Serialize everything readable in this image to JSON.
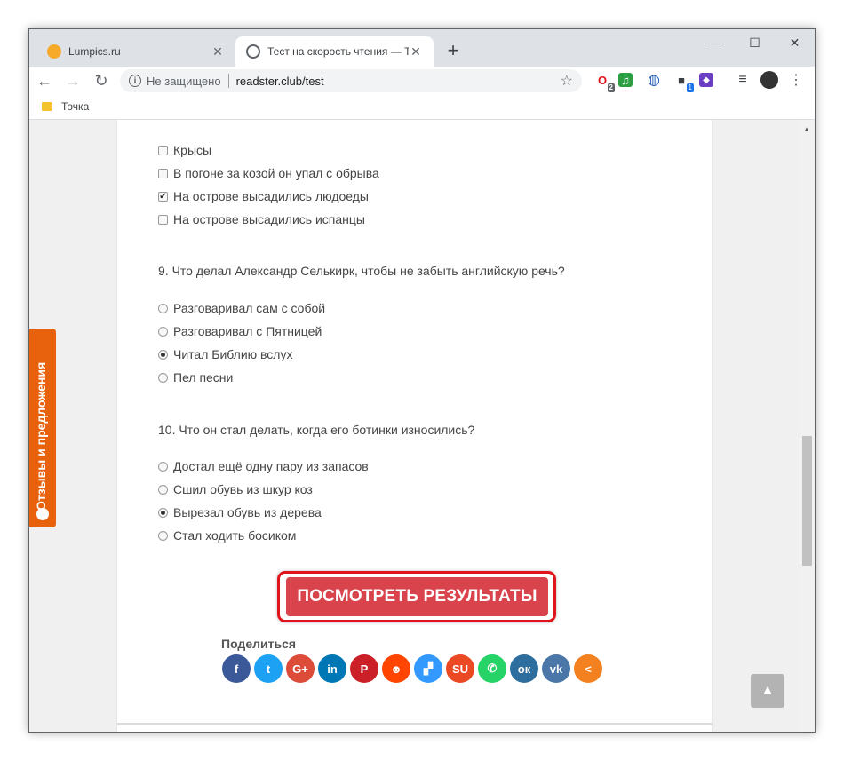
{
  "tabs": [
    {
      "title": "Lumpics.ru",
      "favicon_color": "#f7a92a",
      "active": false
    },
    {
      "title": "Тест на скорость чтения — Тре",
      "favicon_color": "#5f6368",
      "active": true
    }
  ],
  "new_tab_label": "+",
  "window_controls": {
    "minimize": "—",
    "maximize": "☐",
    "close": "✕"
  },
  "nav": {
    "back": "←",
    "forward": "→",
    "reload": "↻"
  },
  "omnibox": {
    "security": "Не защищено",
    "url": "readster.club/test",
    "star": "☆"
  },
  "extensions": [
    {
      "name": "opera-icon",
      "glyph": "O",
      "color": "#e0141c",
      "badge": "2"
    },
    {
      "name": "music-icon",
      "glyph": "♫",
      "color": "#2e9e45",
      "badge": ""
    },
    {
      "name": "vpn-icon",
      "glyph": "◍",
      "color": "#1a56b8",
      "badge": ""
    },
    {
      "name": "cube-icon",
      "glyph": "■",
      "color": "#3c4043",
      "badge": "1"
    },
    {
      "name": "purple-ext-icon",
      "glyph": "◆",
      "color": "#6b3fc4",
      "badge": ""
    },
    {
      "name": "media-icon",
      "glyph": "≡",
      "color": "#3c4043",
      "badge": ""
    }
  ],
  "bookmarks": [
    {
      "label": "Точка"
    }
  ],
  "quiz": {
    "q8_options": [
      {
        "label": "Крысы",
        "checked": false
      },
      {
        "label": "В погоне за козой он упал с обрыва",
        "checked": false
      },
      {
        "label": "На острове высадились людоеды",
        "checked": true
      },
      {
        "label": "На острове высадились испанцы",
        "checked": false
      }
    ],
    "q9": {
      "text": "9. Что делал Александр Селькирк, чтобы не забыть английскую речь?",
      "options": [
        {
          "label": "Разговаривал сам с собой",
          "checked": false
        },
        {
          "label": "Разговаривал с Пятницей",
          "checked": false
        },
        {
          "label": "Читал Библию вслух",
          "checked": true
        },
        {
          "label": "Пел песни",
          "checked": false
        }
      ]
    },
    "q10": {
      "text": "10. Что он стал делать, когда его ботинки износились?",
      "options": [
        {
          "label": "Достал ещё одну пару из запасов",
          "checked": false
        },
        {
          "label": "Сшил обувь из шкур коз",
          "checked": false
        },
        {
          "label": "Вырезал обувь из дерева",
          "checked": true
        },
        {
          "label": "Стал ходить босиком",
          "checked": false
        }
      ]
    },
    "submit_label": "ПОСМОТРЕТЬ РЕЗУЛЬТАТЫ"
  },
  "share": {
    "label": "Поделиться",
    "buttons": [
      {
        "name": "facebook",
        "glyph": "f",
        "color": "#3b5998"
      },
      {
        "name": "twitter",
        "glyph": "t",
        "color": "#1da1f2"
      },
      {
        "name": "google-plus",
        "glyph": "G+",
        "color": "#dd4b39"
      },
      {
        "name": "linkedin",
        "glyph": "in",
        "color": "#0077b5"
      },
      {
        "name": "pinterest",
        "glyph": "P",
        "color": "#cb2027"
      },
      {
        "name": "reddit",
        "glyph": "☻",
        "color": "#ff4500"
      },
      {
        "name": "delicious",
        "glyph": "▞",
        "color": "#3399ff"
      },
      {
        "name": "stumbleupon",
        "glyph": "SU",
        "color": "#eb4924"
      },
      {
        "name": "whatsapp",
        "glyph": "✆",
        "color": "#25d366"
      },
      {
        "name": "odnoklassniki",
        "glyph": "ок",
        "color": "#2e6e9e"
      },
      {
        "name": "vk",
        "glyph": "vk",
        "color": "#4a76a8"
      },
      {
        "name": "share-more",
        "glyph": "<",
        "color": "#f48120"
      }
    ]
  },
  "feedback_tab": "Отзывы и предложения",
  "scroll_top": "▲"
}
